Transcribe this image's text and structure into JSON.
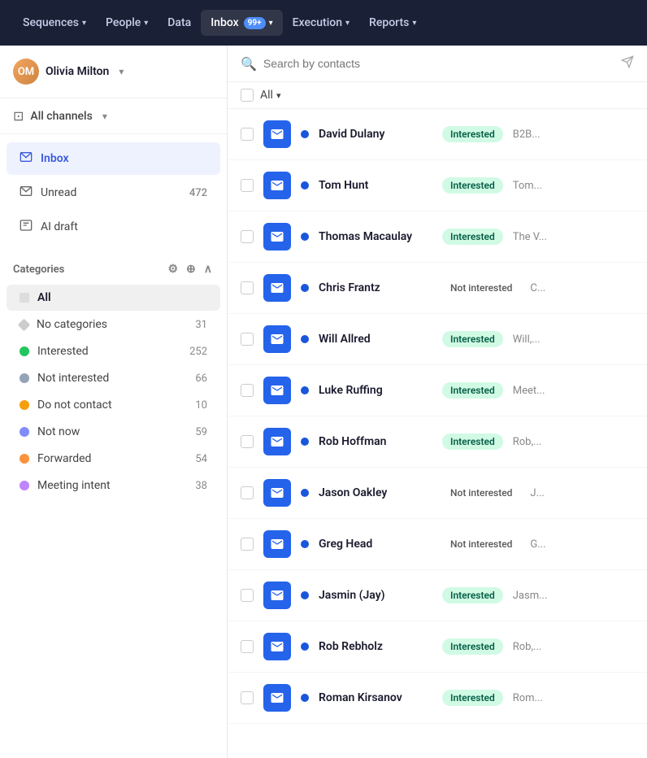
{
  "nav": {
    "items": [
      {
        "label": "Sequences",
        "hasChevron": true,
        "active": false
      },
      {
        "label": "People",
        "hasChevron": true,
        "active": false
      },
      {
        "label": "Data",
        "hasChevron": false,
        "active": false
      },
      {
        "label": "Inbox",
        "hasChevron": true,
        "active": true,
        "badge": "99+"
      },
      {
        "label": "Execution",
        "hasChevron": true,
        "active": false
      },
      {
        "label": "Reports",
        "hasChevron": true,
        "active": false
      }
    ]
  },
  "sidebar": {
    "user": {
      "name": "Olivia Milton",
      "initials": "OM"
    },
    "channel": {
      "label": "All channels"
    },
    "nav_items": [
      {
        "label": "Inbox",
        "icon": "inbox",
        "active": true,
        "count": null
      },
      {
        "label": "Unread",
        "icon": "mail",
        "active": false,
        "count": "472"
      },
      {
        "label": "AI draft",
        "icon": "ai",
        "active": false,
        "count": null
      }
    ],
    "categories_title": "Categories",
    "categories": [
      {
        "label": "All",
        "type": "all",
        "color": "#aaa",
        "active": true,
        "count": null
      },
      {
        "label": "No categories",
        "type": "diamond",
        "color": "#ccc",
        "active": false,
        "count": "31"
      },
      {
        "label": "Interested",
        "type": "dot",
        "color": "#22c55e",
        "active": false,
        "count": "252"
      },
      {
        "label": "Not interested",
        "type": "dot",
        "color": "#94a3b8",
        "active": false,
        "count": "66"
      },
      {
        "label": "Do not contact",
        "type": "dot",
        "color": "#f59e0b",
        "active": false,
        "count": "10"
      },
      {
        "label": "Not now",
        "type": "dot",
        "color": "#818cf8",
        "active": false,
        "count": "59"
      },
      {
        "label": "Forwarded",
        "type": "dot",
        "color": "#fb923c",
        "active": false,
        "count": "54"
      },
      {
        "label": "Meeting intent",
        "type": "dot",
        "color": "#c084fc",
        "active": false,
        "count": "38"
      }
    ]
  },
  "search": {
    "placeholder": "Search by contacts"
  },
  "filter": {
    "label": "All"
  },
  "contacts": [
    {
      "name": "David Dulany",
      "status": "Interested",
      "statusType": "interested",
      "preview": "B2B..."
    },
    {
      "name": "Tom Hunt",
      "status": "Interested",
      "statusType": "interested",
      "preview": "Tom..."
    },
    {
      "name": "Thomas Macaulay",
      "status": "Interested",
      "statusType": "interested",
      "preview": "The V..."
    },
    {
      "name": "Chris Frantz",
      "status": "Not interested",
      "statusType": "not-interested",
      "preview": "C..."
    },
    {
      "name": "Will Allred",
      "status": "Interested",
      "statusType": "interested",
      "preview": "Will,..."
    },
    {
      "name": "Luke Ruffing",
      "status": "Interested",
      "statusType": "interested",
      "preview": "Meet..."
    },
    {
      "name": "Rob Hoffman",
      "status": "Interested",
      "statusType": "interested",
      "preview": "Rob,..."
    },
    {
      "name": "Jason Oakley",
      "status": "Not interested",
      "statusType": "not-interested",
      "preview": "J..."
    },
    {
      "name": "Greg Head",
      "status": "Not interested",
      "statusType": "not-interested",
      "preview": "G..."
    },
    {
      "name": "Jasmin (Jay)",
      "status": "Interested",
      "statusType": "interested",
      "preview": "Jasm..."
    },
    {
      "name": "Rob Rebholz",
      "status": "Interested",
      "statusType": "interested",
      "preview": "Rob,..."
    },
    {
      "name": "Roman Kirsanov",
      "status": "Interested",
      "statusType": "interested",
      "preview": "Rom..."
    }
  ]
}
